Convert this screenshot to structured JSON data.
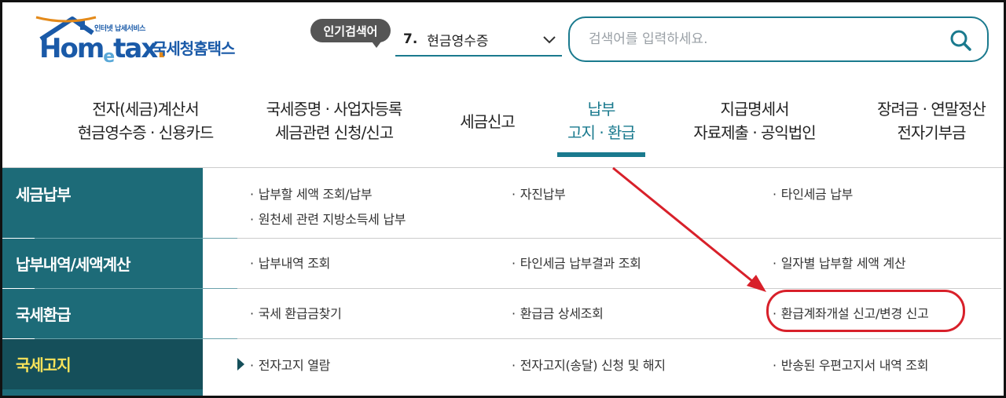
{
  "header": {
    "logo_small": "인터넷 납세서비스",
    "logo_main": "Hometax.",
    "logo_kr": "국세청홈택스",
    "popular_label": "인기검색어",
    "popular_rank": "7.",
    "popular_term": "현금영수증",
    "search_placeholder": "검색어를 입력하세요."
  },
  "nav": [
    {
      "line1": "전자(세금)계산서",
      "line2": "현금영수증 · 신용카드"
    },
    {
      "line1": "국세증명 · 사업자등록",
      "line2": "세금관련 신청/신고"
    },
    {
      "line1": "세금신고",
      "line2": ""
    },
    {
      "line1": "납부",
      "line2": "고지 · 환급"
    },
    {
      "line1": "지급명세서",
      "line2": "자료제출 · 공익법인"
    },
    {
      "line1": "장려금 · 연말정산",
      "line2": "전자기부금"
    }
  ],
  "submenu": [
    {
      "category": "세금납부",
      "links": [
        "납부할 세액 조회/납부",
        "원천세 관련 지방소득세 납부",
        "자진납부",
        "타인세금 납부"
      ]
    },
    {
      "category": "납부내역/세액계산",
      "links": [
        "납부내역 조회",
        "타인세금 납부결과 조회",
        "일자별 납부할 세액 계산"
      ]
    },
    {
      "category": "국세환급",
      "links": [
        "국세 환급금찾기",
        "환급금 상세조회",
        "환급계좌개설 신고/변경 신고"
      ]
    },
    {
      "category": "국세고지",
      "links": [
        "전자고지 열람",
        "전자고지(송달) 신청 및 해지",
        "반송된 우편고지서 내역 조회"
      ]
    }
  ],
  "bullet": "·",
  "colors": {
    "accent": "#1a7a8e",
    "side_bg": "#1d6b78",
    "side_active": "#154f5a",
    "highlight": "#d8202a",
    "logo": "#1a5aa8"
  }
}
